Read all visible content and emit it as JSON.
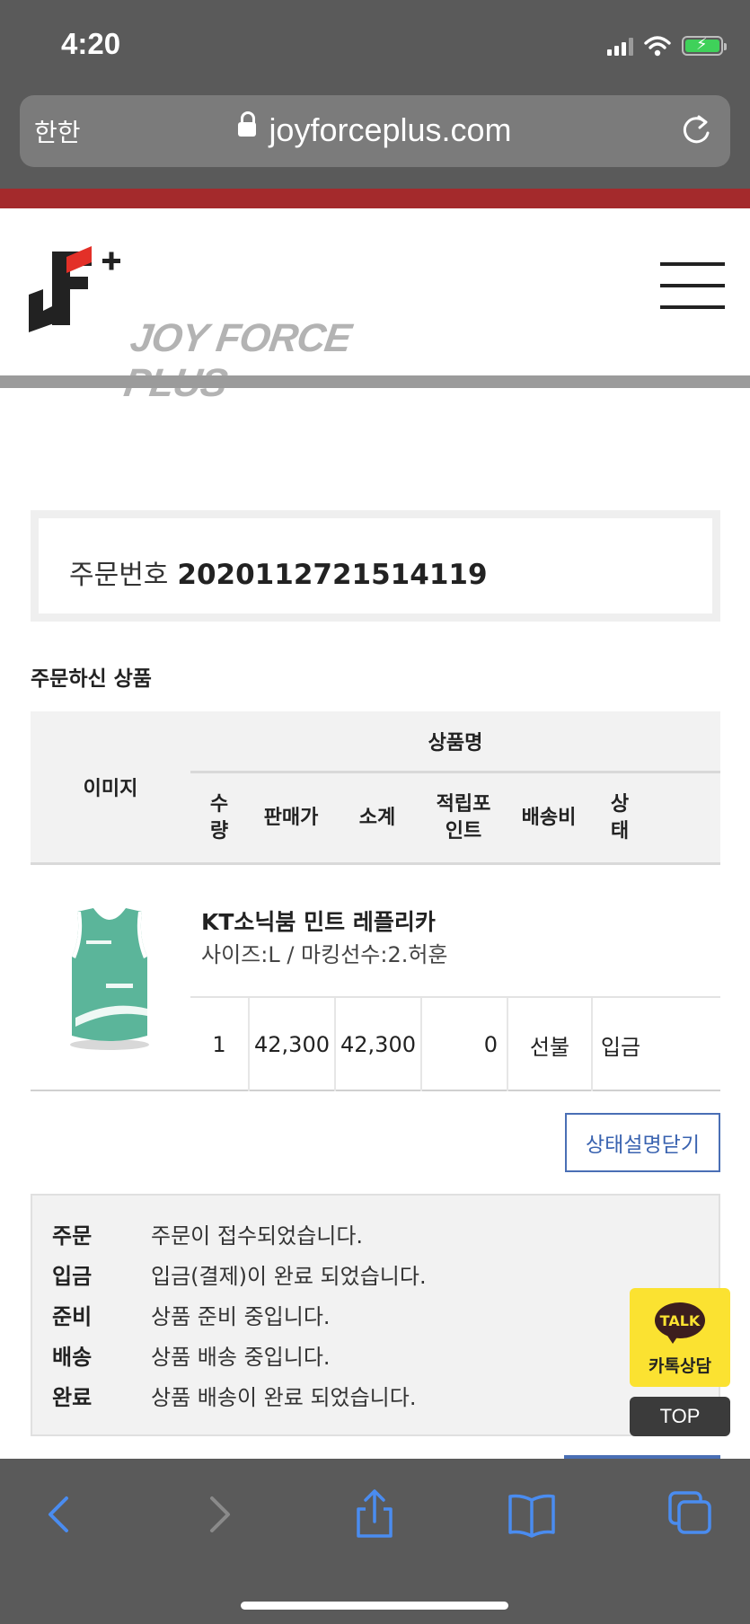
{
  "status_bar": {
    "time": "4:20"
  },
  "browser": {
    "aa_label": "한한",
    "url": "joyforceplus.com"
  },
  "site": {
    "brand": "JOY FORCE PLUS"
  },
  "order": {
    "label": "주문번호",
    "number": "2020112721514119"
  },
  "section_title": "주문하신 상품",
  "table": {
    "headers": {
      "image": "이미지",
      "product_name": "상품명",
      "qty": "수\n량",
      "price": "판매가",
      "subtotal": "소계",
      "points": "적립포\n인트",
      "shipping": "배송비",
      "status": "상\n태"
    },
    "rows": [
      {
        "name": "KT소닉붐 민트 레플리카",
        "option": "사이즈:L / 마킹선수:2.허훈",
        "qty": "1",
        "price": "42,300",
        "subtotal": "42,300",
        "points": "0",
        "shipping": "선불",
        "status": "입금"
      }
    ]
  },
  "status_button": "상태설명닫기",
  "legend": [
    {
      "key": "주문",
      "desc": "주문이 접수되었습니다."
    },
    {
      "key": "입금",
      "desc": "입금(결제)이 완료 되었습니다."
    },
    {
      "key": "준비",
      "desc": "상품 준비 중입니다."
    },
    {
      "key": "배송",
      "desc": "상품 배송 중입니다."
    },
    {
      "key": "완료",
      "desc": "상품 배송이 완료 되었습니다."
    }
  ],
  "kakao": {
    "bubble": "TALK",
    "label": "카톡상담"
  },
  "top_button": "TOP",
  "colors": {
    "accent_red": "#a42a2c",
    "kakao_yellow": "#fbe231",
    "link_blue": "#3a63b0",
    "ios_blue": "#4a8cf0"
  },
  "icons": [
    "lock-icon",
    "reload-icon",
    "back-icon",
    "forward-icon",
    "share-icon",
    "bookmarks-icon",
    "tabs-icon",
    "menu-icon"
  ]
}
